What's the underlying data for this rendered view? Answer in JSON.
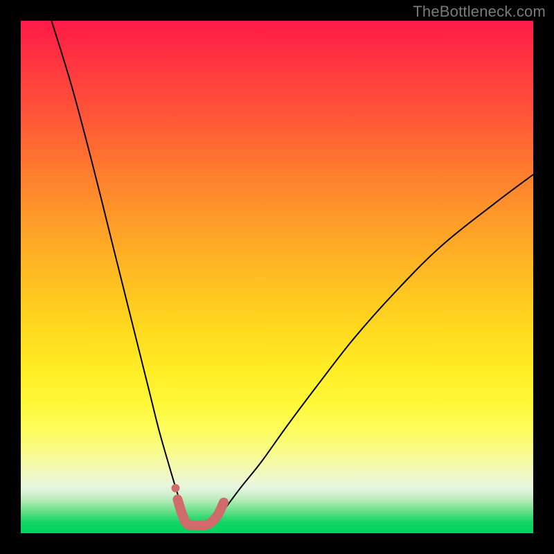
{
  "watermark": "TheBottleneck.com",
  "chart_data": {
    "type": "line",
    "title": "",
    "xlabel": "",
    "ylabel": "",
    "xlim": [
      0,
      100
    ],
    "ylim": [
      0,
      100
    ],
    "grid": false,
    "legend": false,
    "background_gradient": {
      "direction": "vertical",
      "stops": [
        {
          "pos": 0.0,
          "color": "#ff1a46",
          "meaning": "high-bottleneck"
        },
        {
          "pos": 0.5,
          "color": "#ffc321"
        },
        {
          "pos": 0.8,
          "color": "#fdfd60"
        },
        {
          "pos": 0.92,
          "color": "#cff0ce"
        },
        {
          "pos": 1.0,
          "color": "#00d45e",
          "meaning": "no-bottleneck"
        }
      ]
    },
    "series": [
      {
        "name": "bottleneck-curve",
        "color": "#000000",
        "stroke_width": 2,
        "x": [
          6,
          10,
          14,
          18,
          22,
          25,
          27,
          29,
          30.5,
          31.5,
          32.2,
          33,
          34,
          35,
          36,
          37,
          38.5,
          40,
          43,
          47,
          52,
          58,
          65,
          73,
          82,
          92,
          100
        ],
        "y": [
          100,
          87,
          72,
          56,
          40,
          28,
          20,
          13,
          8,
          5,
          3,
          2,
          1.6,
          1.5,
          1.6,
          2,
          3,
          5,
          9,
          14,
          21,
          29,
          38,
          47,
          56,
          64,
          70
        ]
      },
      {
        "name": "optimal-zone-marker",
        "color": "#cf6b6b",
        "stroke_width": 14,
        "linecap": "round",
        "x": [
          30.6,
          31.4,
          32.2,
          33.0,
          34.0,
          35.0,
          36.0,
          37.0,
          38.4,
          39.6
        ],
        "y": [
          6.6,
          4.0,
          2.1,
          1.6,
          1.5,
          1.5,
          1.6,
          2.0,
          3.5,
          6.0
        ]
      }
    ],
    "annotations": [
      {
        "type": "dot",
        "name": "optimal-dot",
        "x": 30.2,
        "y": 8.8,
        "r": 6,
        "color": "#cf6b6b"
      }
    ]
  }
}
